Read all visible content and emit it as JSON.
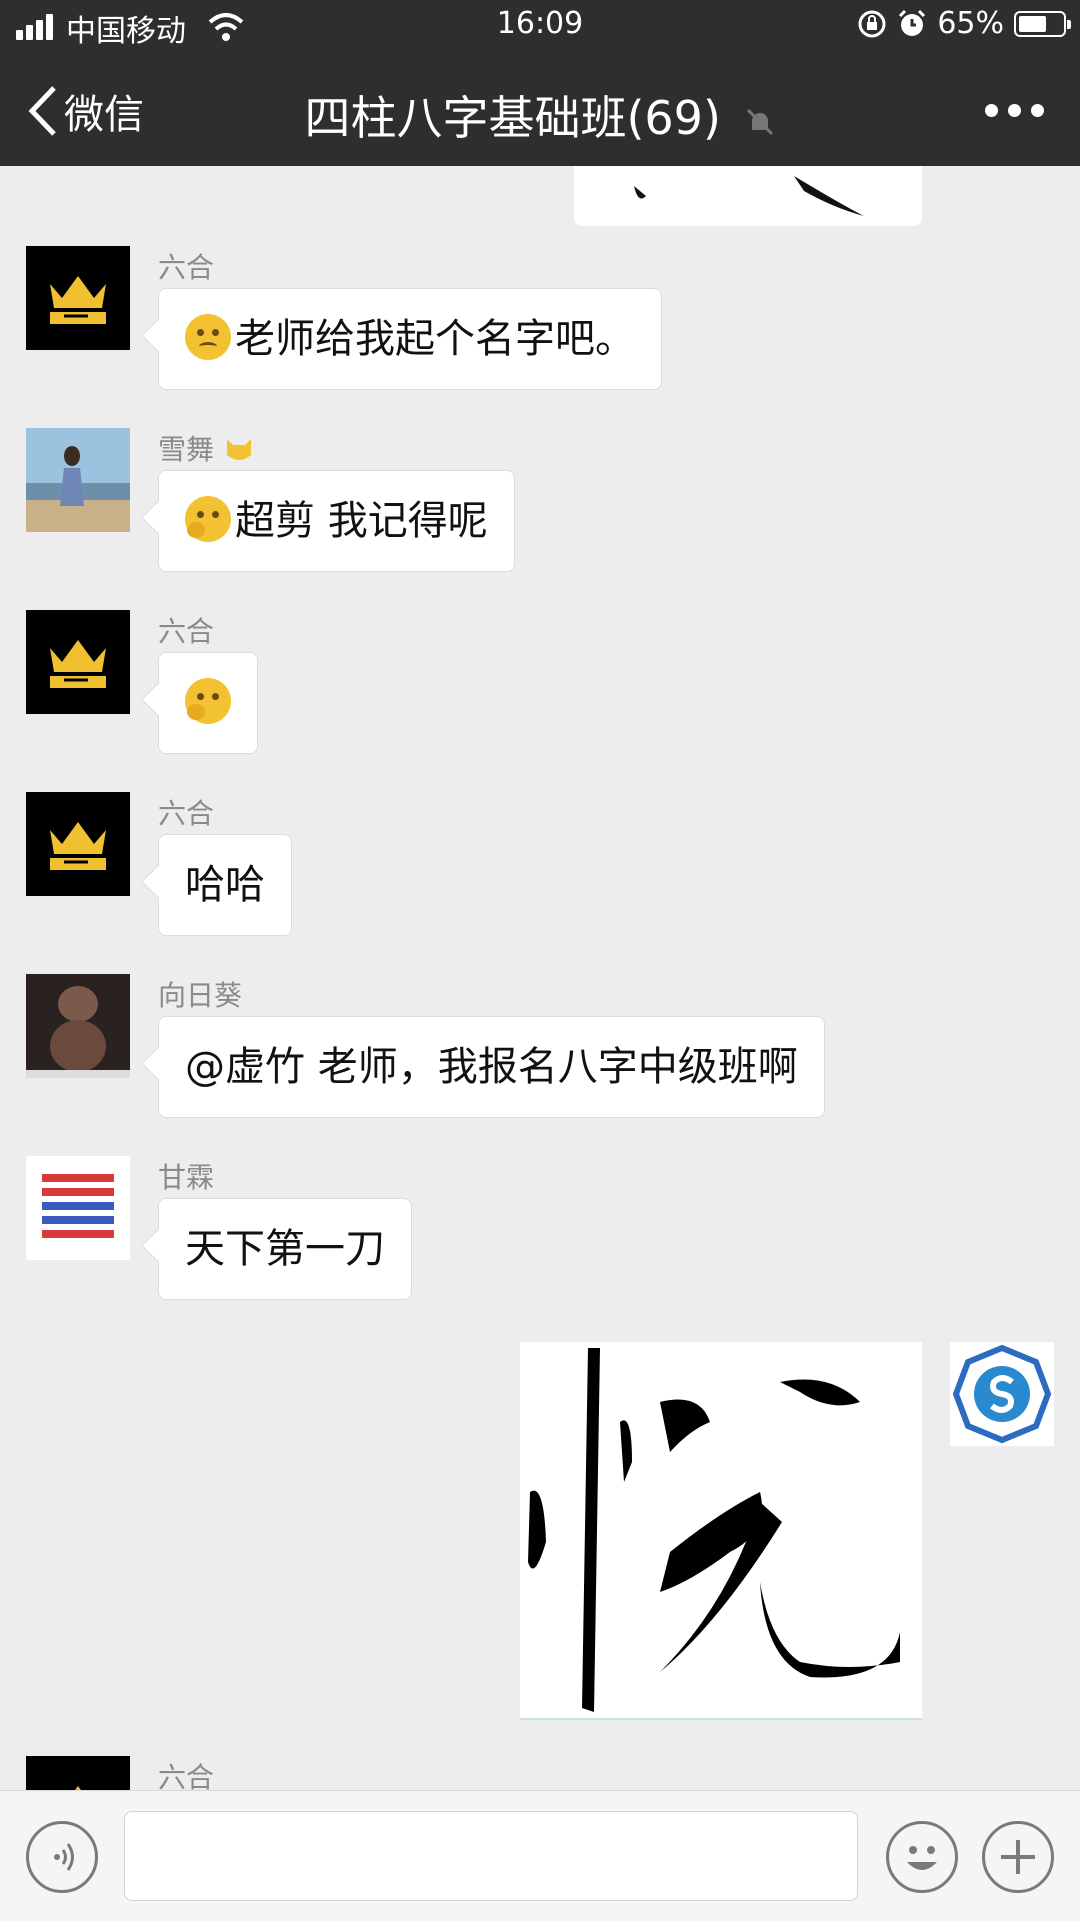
{
  "status": {
    "carrier": "中国移动",
    "time": "16:09",
    "battery": "65%",
    "battery_level": 0.65
  },
  "nav": {
    "back_label": "微信",
    "title": "四柱八字基础班(69)"
  },
  "messages": [
    {
      "sender": "六合",
      "text": "老师给我起个名字吧。"
    },
    {
      "sender": "雪舞",
      "text": "超剪 我记得呢"
    },
    {
      "sender": "六合",
      "text": ""
    },
    {
      "sender": "六合",
      "text": "哈哈"
    },
    {
      "sender": "向日葵",
      "text": "@虚竹 老师，我报名八字中级班啊"
    },
    {
      "sender": "甘霖",
      "text": "天下第一刀"
    },
    {
      "sender": "六合",
      "text": ""
    }
  ],
  "input": {
    "placeholder": ""
  },
  "icons": [
    "signal-icon",
    "wifi-icon",
    "rotation-lock-icon",
    "alarm-icon",
    "battery-icon",
    "back-chevron-icon",
    "mute-bell-icon",
    "more-icon",
    "voice-icon",
    "emoji-icon",
    "plus-icon"
  ]
}
